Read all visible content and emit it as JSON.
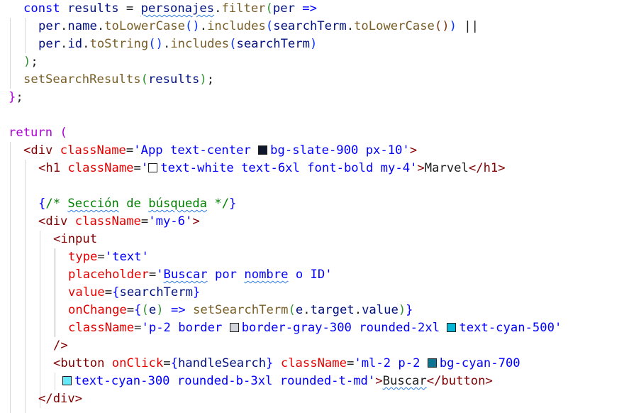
{
  "colors": {
    "bg_slate_900": "#0f172a",
    "text_white": "#ffffff",
    "border_gray_300": "#d1d5db",
    "text_cyan_500": "#06b6d4",
    "bg_cyan_700": "#0e7490",
    "text_cyan_300": "#67e8f9"
  },
  "code": {
    "l1": {
      "const": "const",
      "results": "results",
      "eq": " = ",
      "personajes": "personajes",
      "dot": ".",
      "filter": "filter",
      "po": "(",
      "per": "per",
      "arrow": " =>"
    },
    "l2": {
      "per": "per",
      "d1": ".",
      "name": "name",
      "d2": ".",
      "toLowerCase": "toLowerCase",
      "p1": "()",
      "d3": ".",
      "includes": "includes",
      "po": "(",
      "searchTerm": "searchTerm",
      "d4": ".",
      "toLowerCase2": "toLowerCase",
      "p2": "()",
      "pc": ")",
      "or": " ||"
    },
    "l3": {
      "per": "per",
      "d1": ".",
      "id": "id",
      "d2": ".",
      "toString": "toString",
      "p1": "()",
      "d3": ".",
      "includes": "includes",
      "po": "(",
      "searchTerm": "searchTerm",
      "pc": ")"
    },
    "l4": {
      "pc": ")",
      "semi": ";"
    },
    "l5": {
      "fn": "setSearchResults",
      "po": "(",
      "arg": "results",
      "pc": ")",
      "semi": ";"
    },
    "l6": {
      "bc": "}",
      "semi": ";"
    },
    "l8": {
      "ret": "return",
      "po": " ("
    },
    "l9": {
      "open": "<div",
      "attr": " className",
      "eq": "=",
      "val1": "'App text-center ",
      "val2": "bg-slate-900 px-10'",
      "close": ">"
    },
    "l10": {
      "open": "<h1",
      "attr": " className",
      "eq": "=",
      "val1": "'",
      "val2": "text-white text-6xl font-bold my-4'",
      "close": ">",
      "text": "Marvel",
      "end": "</h1>"
    },
    "l12": {
      "bo": "{",
      "cmt1": "/* ",
      "w1": "Sección",
      "cmt2": " de ",
      "w2": "búsqueda",
      "cmt3": " */",
      "bc": "}"
    },
    "l13": {
      "open": "<div",
      "attr": " className",
      "eq": "=",
      "val": "'my-6'",
      "close": ">"
    },
    "l14": {
      "open": "<input"
    },
    "l15": {
      "attr": "type",
      "eq": "=",
      "val": "'text'"
    },
    "l16": {
      "attr": "placeholder",
      "eq": "=",
      "v1": "'",
      "w1": "Buscar",
      "v2": " por ",
      "w2": "nombre",
      "v3": " o ID'"
    },
    "l17": {
      "attr": "value",
      "eq": "=",
      "bo": "{",
      "var": "searchTerm",
      "bc": "}"
    },
    "l18": {
      "attr": "onChange",
      "eq": "=",
      "bo": "{",
      "po": "(",
      "e": "e",
      "pc": ")",
      "arrow": " => ",
      "fn": "setSearchTerm",
      "po2": "(",
      "e2": "e",
      "d1": ".",
      "target": "target",
      "d2": ".",
      "value": "value",
      "pc2": ")",
      "bc": "}"
    },
    "l19": {
      "attr": "className",
      "eq": "=",
      "val1": "'p-2 border ",
      "val2": "border-gray-300 rounded-2xl ",
      "val3": "text-cyan-500'"
    },
    "l20": {
      "close": "/>"
    },
    "l21": {
      "open": "<button",
      "attr": " onClick",
      "eq": "=",
      "bo": "{",
      "var": "handleSearch",
      "bc": "}",
      "attr2": " className",
      "eq2": "=",
      "val1": "'ml-2 p-2 ",
      "val2": "bg-cyan-700"
    },
    "l22": {
      "val": "text-cyan-300 rounded-b-3xl rounded-t-md'",
      "close": ">",
      "text": "Buscar",
      "end": "</button>"
    },
    "l23": {
      "end": "</div>"
    }
  }
}
